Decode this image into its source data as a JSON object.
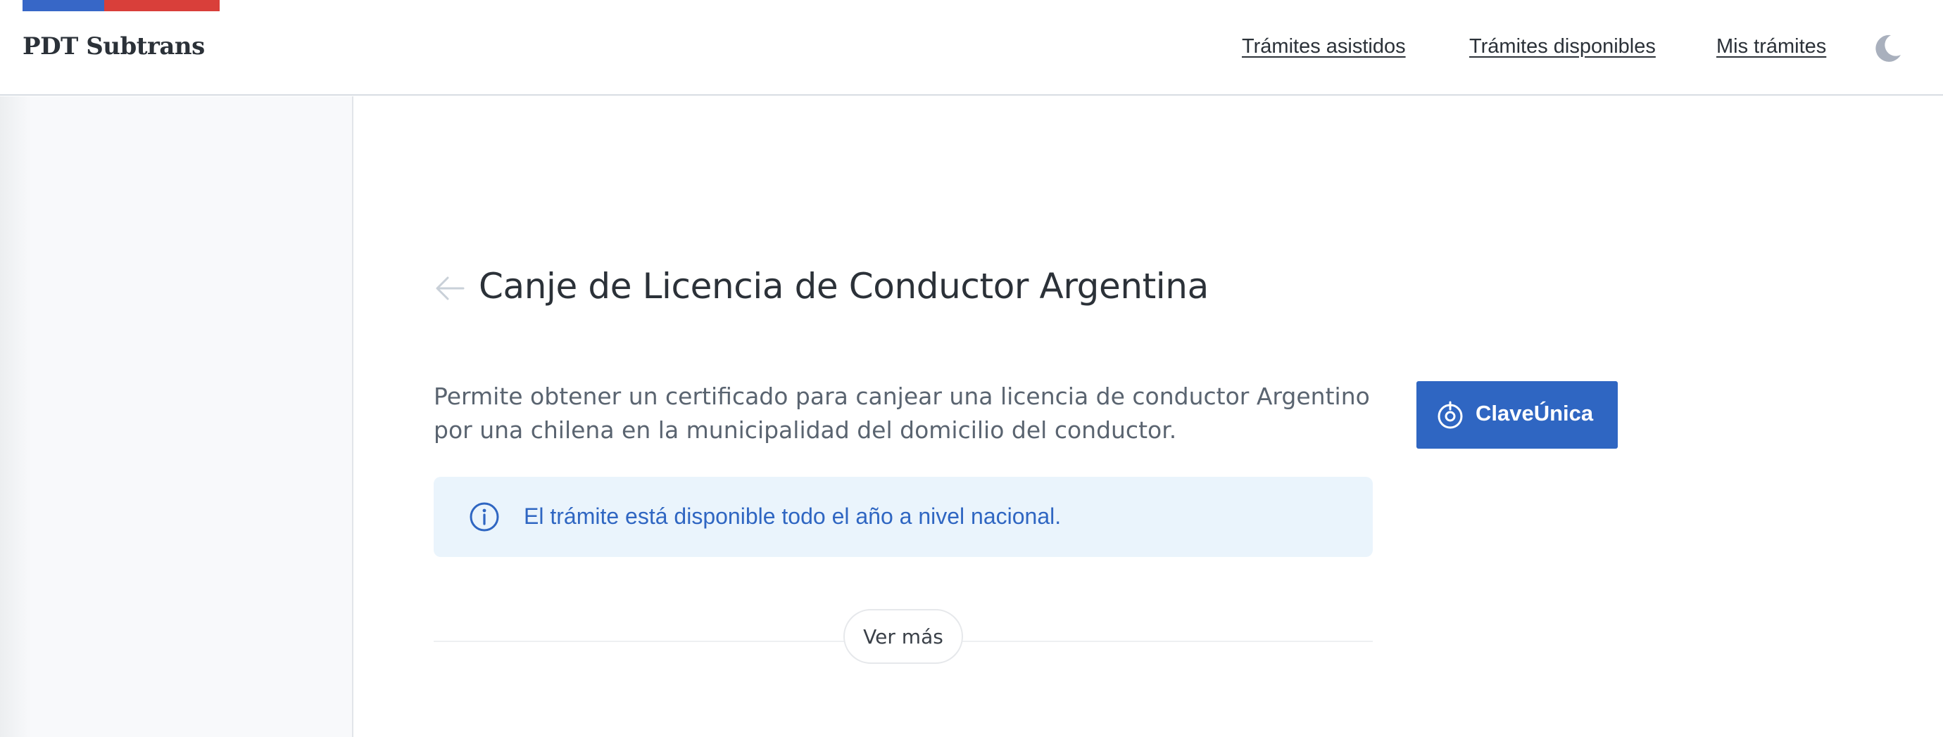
{
  "header": {
    "brand": "PDT Subtrans",
    "nav": {
      "assisted": "Trámites asistidos",
      "available": "Trámites disponibles",
      "mine": "Mis trámites"
    },
    "theme_toggle_icon": "moon-icon"
  },
  "colors": {
    "flag_blue": "#3767c7",
    "flag_red": "#d93f3a",
    "accent": "#2f66c2",
    "alert_bg": "#eaf4fc"
  },
  "main": {
    "title": "Canje de Licencia de Conductor Argentina",
    "back_icon": "arrow-left-icon",
    "description": "Permite obtener un certificado para canjear una licencia de conductor Argentino por una chilena en la municipalidad del domicilio del conductor.",
    "login_button": {
      "label": "ClaveÚnica",
      "icon": "claveunica-icon"
    },
    "alert": {
      "icon": "info-icon",
      "text": "El trámite está disponible todo el año a nivel nacional."
    },
    "more_button": "Ver más"
  }
}
